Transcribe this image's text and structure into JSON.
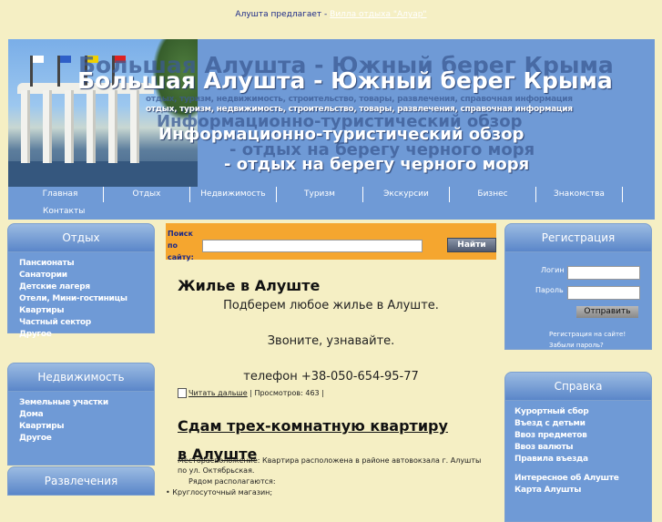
{
  "top_bar": {
    "prefix": "Алушта предлагает - ",
    "link": "Вилла отдыха \"Алуар\""
  },
  "banner": {
    "title": "Большая Алушта - Южный берег Крыма",
    "subtitle": "отдых, туризм, недвижимость, строительство, товары, развлечения, справочная информация",
    "line1": "Информационно-туристический обзор",
    "line2": "- отдых на берегу черного моря"
  },
  "menu": [
    "Главная",
    "Отдых",
    "Недвижимость",
    "Туризм",
    "Экскурсии",
    "Бизнес",
    "Знакомства",
    "Контакты"
  ],
  "left_sidebar": [
    {
      "title": "Отдых",
      "items": [
        "Пансионаты",
        "Санатории",
        "Детские лагеря",
        "Отели, Мини-гостиницы",
        "Квартиры",
        "Частный сектор",
        "Другое"
      ]
    },
    {
      "title": "Недвижимость",
      "items": [
        "Земельные участки",
        "Дома",
        "Квартиры",
        "Другое"
      ]
    },
    {
      "title": "Развлечения",
      "items": []
    }
  ],
  "search": {
    "label": "Поиск по сайту:",
    "button": "Найти",
    "value": ""
  },
  "article1": {
    "title": "Жилье в Алуште",
    "p1": "Подберем любое жилье в Алуште.",
    "p2": "Звоните, узнавайте.",
    "p3": "телефон +38-050-654-95-77",
    "read_more": "Читать дальше",
    "views": " | Просмотров: 463 |"
  },
  "article2": {
    "title": "Сдам трех-комнатную квартиру в Алуште",
    "location": "Месторасположение: Квартира расположена в районе автовокзала г. Алушты по ул. Октябрьская.",
    "nearby": "Рядом располагаются:",
    "bullet1": "Круглосуточный магазин;"
  },
  "registration": {
    "title": "Регистрация",
    "login_label": "Логин",
    "password_label": "Пароль",
    "send": "Отправить",
    "register_link": "Регистрация на сайте!",
    "forgot_link": "Забыли пароль?"
  },
  "reference": {
    "title": "Справка",
    "items": [
      "Курортный сбор",
      "Въезд с детьми",
      "Ввоз предметов",
      "Ввоз валюты",
      "Правила въезда"
    ],
    "items2": [
      "Интересное об Алуште",
      "Карта Алушты"
    ]
  },
  "colors": {
    "background": "#f5efc4",
    "primary_blue": "#6f9ad6",
    "search_orange": "#f5a62f"
  }
}
